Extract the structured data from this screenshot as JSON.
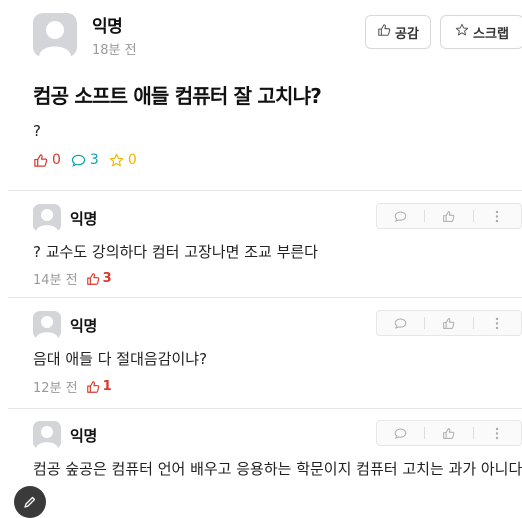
{
  "post": {
    "author": "익명",
    "time": "18분 전",
    "like_button": "공감",
    "scrap_button": "스크랩",
    "title": "컴공 소프트 애들 컴퓨터 잘 고치냐?",
    "body": "?",
    "stats": {
      "likes": "0",
      "comments": "3",
      "scraps": "0"
    }
  },
  "comments": [
    {
      "author": "익명",
      "text": "? 교수도 강의하다 컴터 고장나면 조교 부른다",
      "time": "14분 전",
      "likes": "3"
    },
    {
      "author": "익명",
      "text": "음대 애들 다 절대음감이냐?",
      "time": "12분 전",
      "likes": "1"
    },
    {
      "author": "익명",
      "text": "컴공 숲공은 컴퓨터 언어 배우고 응용하는 학문이지 컴퓨터 고치는 과가 아니다"
    }
  ],
  "colors": {
    "like": "#d8382e",
    "comment": "#0ca5af",
    "scrap": "#f0b400",
    "avatar_bg": "#d3d5d8"
  },
  "icons": {
    "like": "thumbs-up-icon",
    "comment": "comment-bubble-icon",
    "scrap": "star-icon",
    "more": "more-vertical-icon"
  }
}
